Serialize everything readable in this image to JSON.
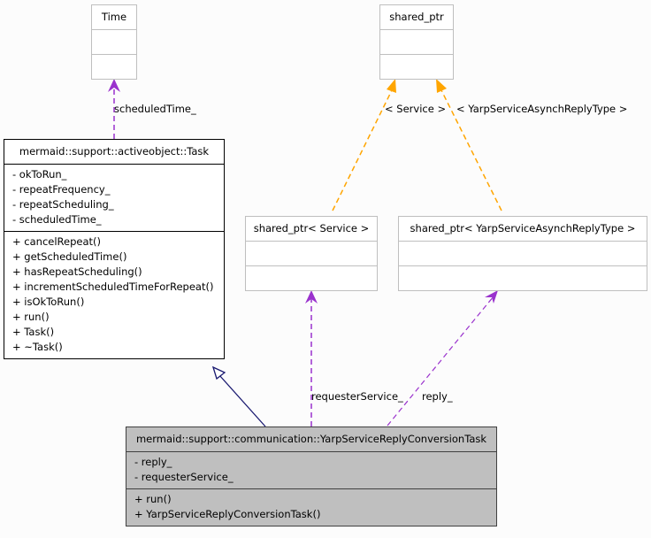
{
  "colors": {
    "usage_edge": "#9a32cd",
    "template_edge": "#ffa500",
    "inheritance_edge": "#191970",
    "focus_fill": "#bfbfbf",
    "grey_border": "#bfbfbf"
  },
  "nodes": {
    "time": {
      "title": "Time",
      "attributes": [],
      "methods": []
    },
    "shared_ptr": {
      "title": "shared_ptr",
      "attributes": [],
      "methods": []
    },
    "task": {
      "title": "mermaid::support::activeobject::Task",
      "attributes": [
        "- okToRun_",
        "- repeatFrequency_",
        "- repeatScheduling_",
        "- scheduledTime_"
      ],
      "methods": [
        "+ cancelRepeat()",
        "+ getScheduledTime()",
        "+ hasRepeatScheduling()",
        "+ incrementScheduledTimeForRepeat()",
        "+ isOkToRun()",
        "+ run()",
        "+ Task()",
        "+ ~Task()"
      ]
    },
    "shared_ptr_service": {
      "title": "shared_ptr< Service >",
      "attributes": [],
      "methods": []
    },
    "shared_ptr_reply": {
      "title": "shared_ptr< YarpServiceAsynchReplyType >",
      "attributes": [],
      "methods": []
    },
    "conversion_task": {
      "title": "mermaid::support::communication::YarpServiceReplyConversionTask",
      "attributes": [
        "- reply_",
        "- requesterService_"
      ],
      "methods": [
        "+ run()",
        "+ YarpServiceReplyConversionTask()"
      ]
    }
  },
  "edges": {
    "scheduled_time": "scheduledTime_",
    "template_service": "< Service >",
    "template_reply": "< YarpServiceAsynchReplyType >",
    "requester_service": "requesterService_",
    "reply": "reply_"
  }
}
